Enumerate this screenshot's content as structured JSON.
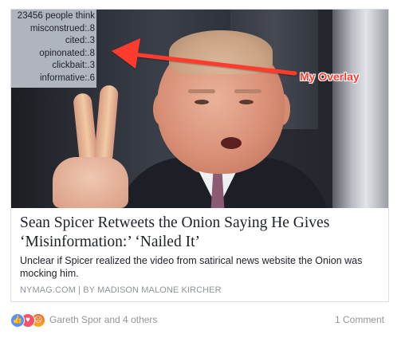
{
  "overlay": {
    "lines": [
      "23456 people think",
      "misconstrued:.8",
      "cited:.3",
      "opinonated:.8",
      "clickbait:.3",
      "informative:.6"
    ],
    "label": "My Overlay"
  },
  "article": {
    "headline": "Sean Spicer Retweets the Onion Saying He Gives ‘Misinformation:’ ‘Nailed It’",
    "description": "Unclear if Spicer realized the video from satirical news website the Onion was mocking him.",
    "source": "NYMAG.COM | BY MADISON MALONE KIRCHER"
  },
  "footer": {
    "reaction_icons": [
      "like-icon",
      "love-icon",
      "angry-icon"
    ],
    "reactors": "Gareth Spor and 4 others",
    "comments": "1 Comment"
  },
  "colors": {
    "annotation": "#ff3b2f",
    "meta_text": "#90949c",
    "like": "#5890ff",
    "love": "#f25268"
  }
}
